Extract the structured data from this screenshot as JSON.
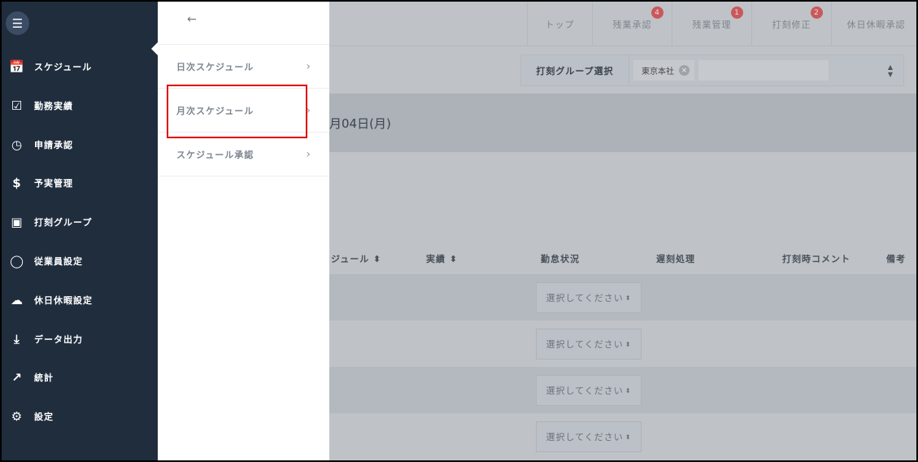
{
  "sidebar": {
    "items": [
      {
        "label": "スケジュール",
        "icon": "calendar-icon"
      },
      {
        "label": "勤務実績",
        "icon": "calendar-check-icon"
      },
      {
        "label": "申請承認",
        "icon": "clock-icon"
      },
      {
        "label": "予実管理",
        "icon": "dollar-icon"
      },
      {
        "label": "打刻グループ",
        "icon": "briefcase-icon"
      },
      {
        "label": "従業員設定",
        "icon": "user-icon"
      },
      {
        "label": "休日休暇設定",
        "icon": "cloud-icon"
      },
      {
        "label": "データ出力",
        "icon": "download-icon"
      },
      {
        "label": "統計",
        "icon": "chart-icon"
      },
      {
        "label": "設定",
        "icon": "gear-icon"
      }
    ]
  },
  "submenu": {
    "back": "←",
    "items": [
      {
        "label": "日次スケジュール"
      },
      {
        "label": "月次スケジュール",
        "highlighted": true
      },
      {
        "label": "スケジュール承認"
      }
    ]
  },
  "topnav": [
    {
      "label": "トップ"
    },
    {
      "label": "残業承認",
      "badge": "4"
    },
    {
      "label": "残業管理",
      "badge": "1"
    },
    {
      "label": "打刻修正",
      "badge": "2"
    },
    {
      "label": "休日休暇承認"
    }
  ],
  "filter": {
    "label": "打刻グループ選択",
    "tag": "東京本社"
  },
  "date": "月04日(月)",
  "table": {
    "headers": [
      "ジュール ⬍",
      "実績 ⬍",
      "勤怠状況",
      "遅刻処理",
      "打刻時コメント",
      "備考"
    ],
    "rows": [
      {
        "status": "選択してください"
      },
      {
        "status": "選択してください"
      },
      {
        "status": "選択してください"
      },
      {
        "status": "選択してください"
      }
    ]
  },
  "colors": {
    "sidebar": "#1f2d3d",
    "highlight": "#e00000",
    "badge": "#c9585c"
  }
}
